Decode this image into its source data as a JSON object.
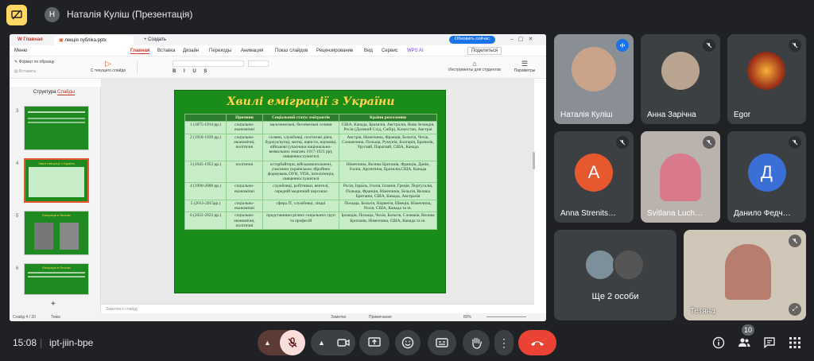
{
  "topbar": {
    "presenter_initial": "Н",
    "presenter_title": "Наталія Куліш (Презентація)"
  },
  "app": {
    "tabs": [
      {
        "label": "Главная"
      },
      {
        "label": "лекція публіка.pptx"
      },
      {
        "label": "Создать"
      }
    ],
    "update_button": "Обновить сейчас",
    "menu": {
      "file_menu": "Меню",
      "items": [
        "Главная",
        "Вставка",
        "Дизайн",
        "Переходы",
        "Анимация",
        "Показ слайдов",
        "Рецензирование",
        "Вид",
        "Сервис",
        "WPS AI"
      ],
      "share": "Поделиться"
    },
    "ribbon": {
      "format_painter": "Формат по образцу",
      "paste": "Вставить",
      "from_current_slide": "С текущего слайда",
      "tools_for_students": "Инструменты для студентов",
      "parameters": "Параметры"
    },
    "panel_tabs": [
      "Структура",
      "Слайды"
    ],
    "thumbnails": [
      {
        "num": "3"
      },
      {
        "num": "4",
        "title": "Хвилі еміграції з України"
      },
      {
        "num": "5",
        "title": "Еміграція в Японію"
      },
      {
        "num": "6",
        "title": "Еміграція в Японію"
      }
    ],
    "slide": {
      "title": "Хвилі еміграції з України",
      "headers": [
        "",
        "Причини",
        "Соціальний статус емігрантів",
        "Країни розселення"
      ],
      "rows": [
        {
          "period": "1 (1875-1914 рр.)",
          "reason": "соціально-економічні",
          "status": "малоземельні, безземельні селяни",
          "countries": "США, Канада, Бразилія, Австралія, Нова Зеландія, Росія (Далекий Схід, Сибір), Казахстан, Австрія"
        },
        {
          "period": "2 (1918-1939 рр.)",
          "reason": "соціально-економічні, політичні",
          "status": "селяни, службовці, політичні діячі, буржуа/купці, митці, юристи, науковці, військові (учасники національно-визвольних змагань 1917-1921 рр), священнослужителі",
          "countries": "Австрія, Німеччина, Франція, Бельгія, Чехія, Словаччина, Польща, Румунія, Болгарія, Бразилія, Уругвай, Парагвай, США, Канада"
        },
        {
          "period": "3 (1945-1953 рр.)",
          "reason": "політичні",
          "status": "остарбайтери, військовополонені, учасники українських збройних формувань ОУН, УПА, інтелігенція, священнослужителі",
          "countries": "Німеччина, Велика Британія, Франція, Данія, Італія, Аргентина, Бразилія,США, Канада"
        },
        {
          "period": "4 (1990-2000 рр.)",
          "reason": "соціально-економічні",
          "status": "службовці, робітники, вчителі, середній медичний персонал",
          "countries": "Росія, Ізраїль, Італія, Іспанія, Греція, Португалія, Польща, Франція, Німеччина, Бельгія, Велика Британія, США, Канада, Австралія"
        },
        {
          "period": "5 (2013-2015рр.)",
          "reason": "соціально-економічні",
          "status": "сфера IT, службовці, лікарі",
          "countries": "Польща, Бельгія, Норвегія, Швеція, Німеччина, Росія, США, Канада та ін."
        },
        {
          "period": "6 (2022-2023 рр.)",
          "reason": "соціально-економічні, політичні",
          "status": "представники різних соціальних груп та професій",
          "countries": "Ірландія, Польща, Чехія, Бельгія, Словакія, Велика Британія, Німеччина, США, Канада та ін."
        }
      ]
    },
    "notes_placeholder": "Заметки к слайду",
    "status": {
      "slide_counter": "Слайд 4 / 20",
      "theme": "Тема",
      "notes": "Заметки",
      "comment": "Примечание",
      "zoom": "80%"
    }
  },
  "participants": [
    {
      "name": "Наталія Куліш",
      "type": "video",
      "bg": "#8a8f96"
    },
    {
      "name": "Анна Зарічна",
      "type": "photo",
      "bg": "#5a4a3e"
    },
    {
      "name": "Egor",
      "type": "photo",
      "bg": "#5a2f1e"
    },
    {
      "name": "Anna Strenits…",
      "type": "letter",
      "letter": "A",
      "bg": "#e8582f"
    },
    {
      "name": "Svitlana Luch…",
      "type": "video",
      "bg": "#b9b2ad"
    },
    {
      "name": "Данило Федч…",
      "type": "letter",
      "letter": "Д",
      "bg": "#3c6fd6"
    },
    {
      "name": "Ще 2 особи",
      "type": "group"
    },
    {
      "name": "Тетяна",
      "type": "video",
      "bg": "#cfc6b8"
    }
  ],
  "bottombar": {
    "time": "15:08",
    "meeting_code": "ipt-jiin-bpe",
    "participants_count": "10"
  },
  "colors": {
    "end_call": "#ea4335",
    "mic_off": "#f9dedc",
    "tile_bg": "#3c4043",
    "slide_green": "#1a8c1a",
    "title_yellow": "#ffd54a"
  }
}
